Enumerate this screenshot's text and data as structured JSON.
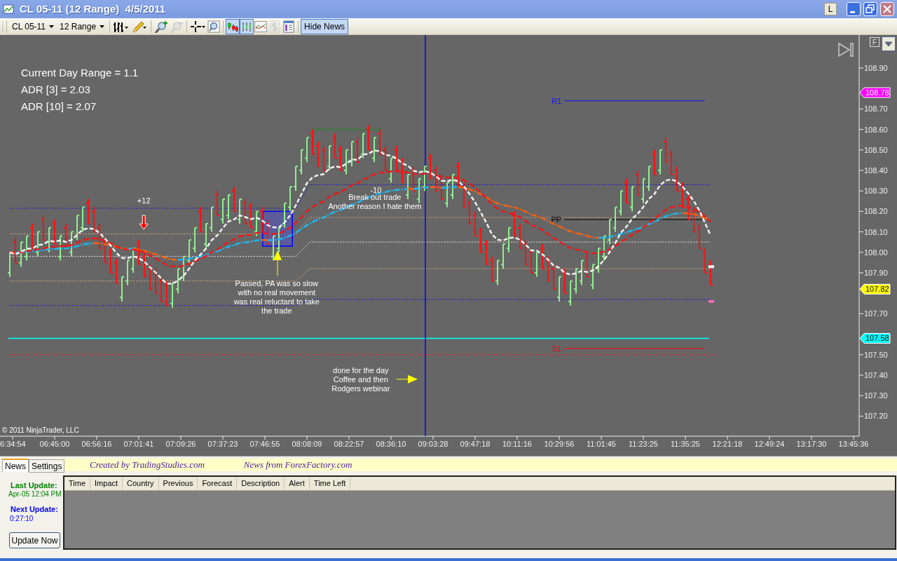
{
  "window": {
    "title": "CL 05-11 (12 Range)  4/5/2011",
    "link_button": "L"
  },
  "toolbar": {
    "instrument": "CL 05-11",
    "period": "12 Range",
    "tools": [
      {
        "kind": "bar-chart",
        "selected": false,
        "disabled": false
      },
      {
        "kind": "pencil",
        "selected": false,
        "disabled": false
      },
      {
        "kind": "zoom-in",
        "selected": false,
        "disabled": false
      },
      {
        "kind": "zoom-out",
        "selected": false,
        "disabled": true
      },
      {
        "kind": "crosshair",
        "selected": false,
        "disabled": false
      },
      {
        "kind": "magnifier",
        "selected": false,
        "disabled": false
      },
      {
        "kind": "ohlc-style",
        "selected": true,
        "disabled": false
      },
      {
        "kind": "candle-style",
        "selected": true,
        "disabled": false
      },
      {
        "kind": "line-style",
        "selected": false,
        "disabled": false
      },
      {
        "kind": "dollar",
        "selected": false,
        "disabled": true
      },
      {
        "kind": "properties",
        "selected": false,
        "disabled": false
      }
    ],
    "hide_news": {
      "label": "Hide News",
      "selected": true
    }
  },
  "chart": {
    "info_lines": [
      "Current Day Range = 1.1",
      "ADR [3] = 2.03",
      "ADR [10] = 2.07"
    ],
    "f_button": "F",
    "price_axis": [
      "108.90",
      "108.70",
      "108.60",
      "108.50",
      "108.40",
      "108.30",
      "108.20",
      "108.10",
      "108.00",
      "107.90",
      "107.70",
      "107.50",
      "107.40",
      "107.30",
      "107.20"
    ],
    "time_axis": [
      "6:34:54",
      "06:45:00",
      "06:56:16",
      "07:01:41",
      "07:09:26",
      "07:37:23",
      "07:46:55",
      "08:08:09",
      "08:22:57",
      "08:36:10",
      "09:03:28",
      "09:47:18",
      "10:11:16",
      "10:29:56",
      "11:01:45",
      "11:23:25",
      "11:35:25",
      "12:21:18",
      "12:49:24",
      "13:17:30",
      "13:45:36"
    ],
    "levels": [
      {
        "label": "R1",
        "color": "#1010ff"
      },
      {
        "label": "PP",
        "color": "#000000"
      },
      {
        "label": "S1",
        "color": "#ff0000"
      }
    ],
    "notes": [
      {
        "lines": [
          "+12"
        ]
      },
      {
        "lines": [
          "-10"
        ]
      },
      {
        "lines": [
          "Break out trade",
          "Another reason I hate them"
        ]
      },
      {
        "lines": [
          "Passed, PA was so slow",
          "with no real movement",
          "was real reluctant to take",
          "the trade"
        ]
      },
      {
        "lines": [
          "done for the day",
          "Coffee and then",
          "Rodgers webinar"
        ]
      }
    ],
    "price_tags": [
      {
        "label": "108.78",
        "color": "#ff00ff"
      },
      {
        "label": "107.82",
        "color": "#ffff00"
      },
      {
        "label": "107.58",
        "color": "#00ffff"
      }
    ],
    "copyright": "© 2011 NinjaTrader, LLC"
  },
  "news": {
    "tabs": [
      {
        "label": "News",
        "selected": true
      },
      {
        "label": "Settings",
        "selected": false
      }
    ],
    "credits": [
      "Created by TradingStudies.com",
      "News from ForexFactory.com"
    ],
    "last_update": {
      "label": "Last Update:",
      "value": "Apr-05 12:04 PM"
    },
    "next_update": {
      "label": "Next Update:",
      "value": "0:27:10"
    },
    "update_button": "Update Now",
    "columns": [
      "Time",
      "Impact",
      "Country",
      "Previous",
      "Forecast",
      "Description",
      "Alert",
      "Time Left"
    ]
  }
}
